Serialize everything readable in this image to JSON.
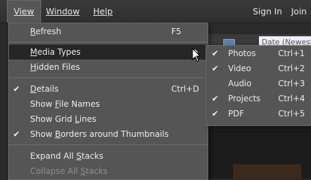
{
  "menubar": {
    "view": "View",
    "window": "Window",
    "help": "Help",
    "sign_in": "Sign In",
    "join": "Join"
  },
  "background": {
    "sort_value": "Date (Newest"
  },
  "view_menu": {
    "refresh": {
      "label": "Refresh",
      "shortcut": "F5"
    },
    "media_types": {
      "label": "Media Types"
    },
    "hidden_files": {
      "label": "Hidden Files"
    },
    "details": {
      "label": "Details",
      "shortcut": "Ctrl+D",
      "checked": true
    },
    "show_file_names": {
      "label": "Show File Names",
      "checked": false
    },
    "show_grid_lines": {
      "label": "Show Grid Lines",
      "checked": false
    },
    "show_borders": {
      "label": "Show Borders around Thumbnails",
      "checked": true
    },
    "expand_all_stacks": {
      "label": "Expand All Stacks",
      "enabled": true
    },
    "collapse_all_stacks": {
      "label": "Collapse All Stacks",
      "enabled": false
    }
  },
  "media_types_submenu": [
    {
      "label": "Photos",
      "shortcut": "Ctrl+1",
      "checked": true
    },
    {
      "label": "Video",
      "shortcut": "Ctrl+2",
      "checked": true
    },
    {
      "label": "Audio",
      "shortcut": "Ctrl+3",
      "checked": false
    },
    {
      "label": "Projects",
      "shortcut": "Ctrl+4",
      "checked": true
    },
    {
      "label": "PDF",
      "shortcut": "Ctrl+5",
      "checked": true
    }
  ],
  "glyphs": {
    "check": "✔"
  }
}
